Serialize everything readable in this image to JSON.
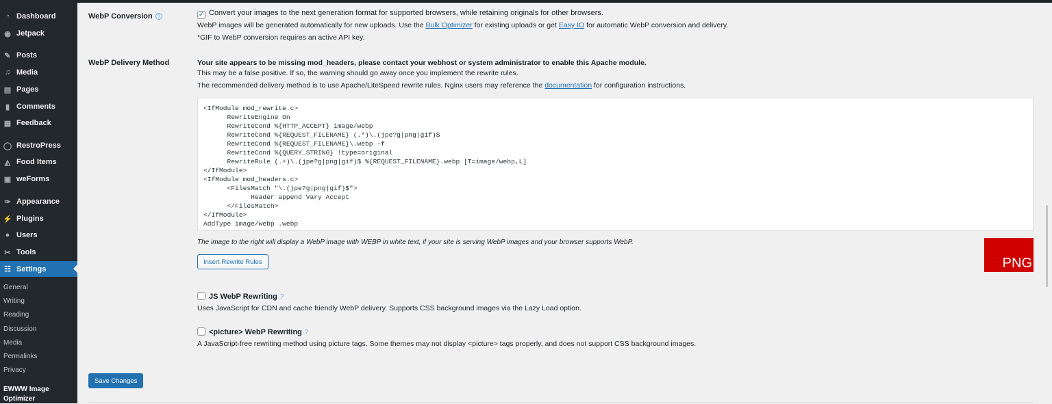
{
  "sidebar": {
    "items": [
      {
        "label": "Dashboard",
        "icon": "dashboard-icon",
        "glyph": "◔"
      },
      {
        "label": "Jetpack",
        "icon": "jetpack-icon",
        "glyph": "◉"
      },
      {
        "label": "Posts",
        "icon": "pin-icon",
        "glyph": "✎"
      },
      {
        "label": "Media",
        "icon": "media-icon",
        "glyph": "♫"
      },
      {
        "label": "Pages",
        "icon": "pages-icon",
        "glyph": "▤"
      },
      {
        "label": "Comments",
        "icon": "comments-icon",
        "glyph": "▮"
      },
      {
        "label": "Feedback",
        "icon": "feedback-icon",
        "glyph": "▦"
      },
      {
        "label": "RestroPress",
        "icon": "restropress-icon",
        "glyph": "◯"
      },
      {
        "label": "Food Items",
        "icon": "food-icon",
        "glyph": "◭"
      },
      {
        "label": "weForms",
        "icon": "weforms-icon",
        "glyph": "▣"
      },
      {
        "label": "Appearance",
        "icon": "appearance-icon",
        "glyph": "✑"
      },
      {
        "label": "Plugins",
        "icon": "plugins-icon",
        "glyph": "⚡"
      },
      {
        "label": "Users",
        "icon": "users-icon",
        "glyph": "●"
      },
      {
        "label": "Tools",
        "icon": "tools-icon",
        "glyph": "✂"
      },
      {
        "label": "Settings",
        "icon": "settings-icon",
        "glyph": "☷"
      }
    ],
    "submenu": [
      "General",
      "Writing",
      "Reading",
      "Discussion",
      "Media",
      "Permalinks",
      "Privacy"
    ],
    "current_sub": "EWWW Image Optimizer"
  },
  "webp_conversion": {
    "label": "WebP Conversion",
    "help": "?",
    "checked": true,
    "checkbox_text": "Convert your images to the next generation format for supported browsers, while retaining originals for other browsers.",
    "desc_1": "WebP images will be generated automatically for new uploads. Use the ",
    "link_1": "Bulk Optimizer",
    "desc_2": " for existing uploads or get ",
    "link_2": "Easy IO",
    "desc_3": " for automatic WebP conversion and delivery.",
    "note": "*GIF to WebP conversion requires an active API key."
  },
  "delivery": {
    "label": "WebP Delivery Method",
    "warning": "Your site appears to be missing mod_headers, please contact your webhost or system administrator to enable this Apache module.",
    "false_positive": "This may be a false positive. If so, the warning should go away once you implement the rewrite rules.",
    "recommend_1": "The recommended delivery method is to use Apache/LiteSpeed rewrite rules. Nginx users may reference the ",
    "recommend_link": "documentation",
    "recommend_2": " for configuration instructions.",
    "code": "<IfModule mod_rewrite.c>\n\tRewriteEngine On\n\tRewriteCond %{HTTP_ACCEPT} image/webp\n\tRewriteCond %{REQUEST_FILENAME} (.*)\\.(jpe?g|png|gif)$\n\tRewriteCond %{REQUEST_FILENAME}\\.webp -f\n\tRewriteCond %{QUERY_STRING} !type=original\n\tRewriteRule (.+)\\.(jpe?g|png|gif)$ %{REQUEST_FILENAME}.webp [T=image/webp,L]\n</IfModule>\n<IfModule mod_headers.c>\n\t<FilesMatch \"\\.(jpe?g|png|gif)$\">\n\t\tHeader append Vary Accept\n\t</FilesMatch>\n</IfModule>\nAddType image/webp .webp",
    "test_note": "The image to the right will display a WebP image with WEBP in white text, if your site is serving WebP images and your browser supports WebP.",
    "test_image_text": "PNG",
    "test_image_color": "#d10000",
    "insert_button": "Insert Rewrite Rules"
  },
  "js_rewriting": {
    "label": "JS WebP Rewriting",
    "help": "?",
    "checked": false,
    "desc": "Uses JavaScript for CDN and cache friendly WebP delivery. Supports CSS background images via the Lazy Load option."
  },
  "picture_rewriting": {
    "label": "<picture> WebP Rewriting",
    "help": "?",
    "checked": false,
    "desc": "A JavaScript-free rewriting method using picture tags. Some themes may not display <picture> tags properly, and does not support CSS background images."
  },
  "save_button": "Save Changes",
  "colors": {
    "accent": "#2271b1",
    "sidebar": "#23282d"
  }
}
